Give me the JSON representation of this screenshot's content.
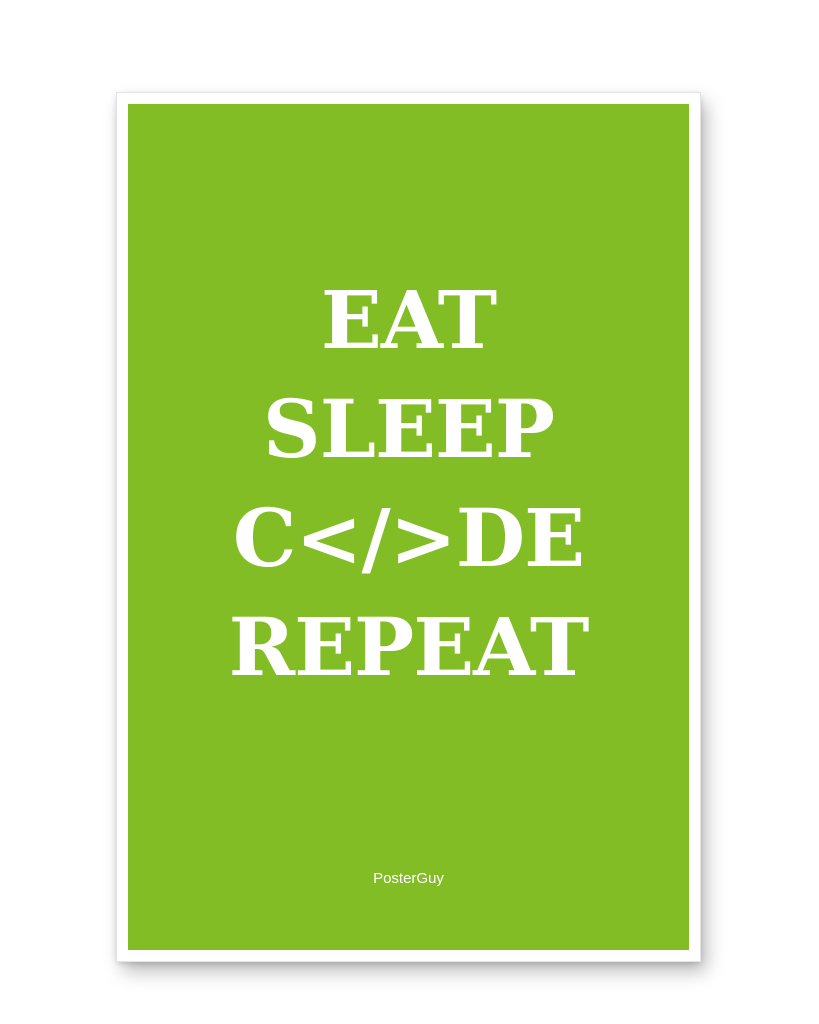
{
  "poster": {
    "lines": [
      "EAT",
      "SLEEP",
      "C</>DE",
      "REPEAT"
    ],
    "brand": "PosterGuy"
  },
  "colors": {
    "panel": "#82bd26",
    "text": "#ffffff",
    "border": "#ffffff"
  }
}
